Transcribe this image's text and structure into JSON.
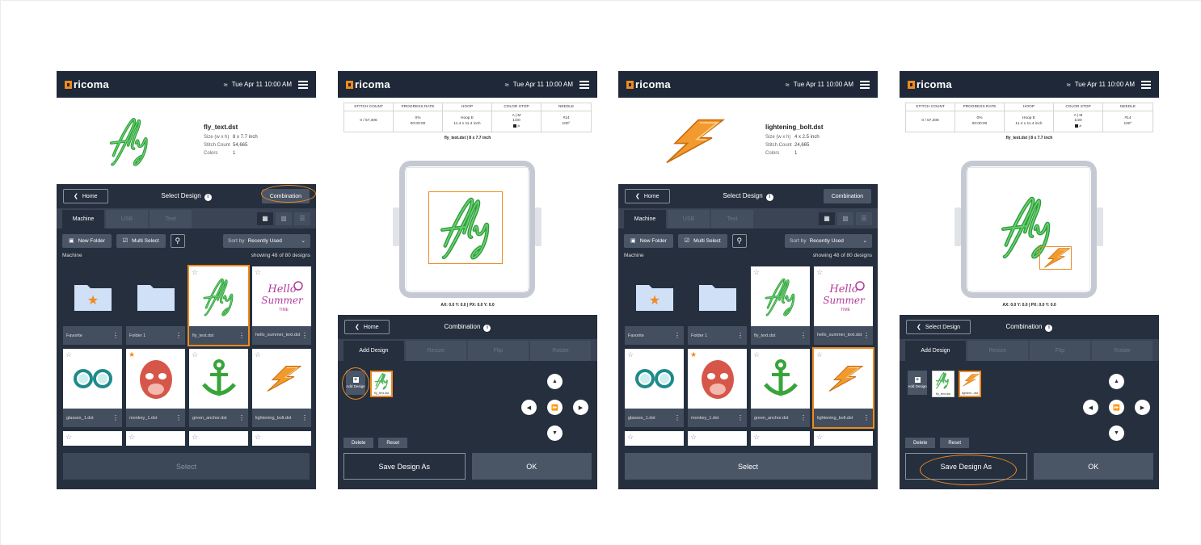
{
  "topbar": {
    "logo": "ricoma",
    "datetime": "Tue Apr 11  10:00 AM"
  },
  "select_panels": [
    {
      "file": {
        "name": "fly_text.dst",
        "size_label": "Size (w x h)",
        "size": "8 x 7.7 inch",
        "stitch_label": "Stitch Count",
        "stitch": "54,665",
        "colors_label": "Colors",
        "colors": "1"
      }
    },
    {
      "file": {
        "name": "lightening_bolt.dst",
        "size_label": "Size (w x h)",
        "size": "4 x 2.5 inch",
        "stitch_label": "Stitch Count",
        "stitch": "24,665",
        "colors_label": "Colors",
        "colors": "1"
      }
    }
  ],
  "select": {
    "home": "Home",
    "title": "Select Design",
    "combination": "Combination",
    "tabs": [
      "Machine",
      "USB",
      "Text"
    ],
    "new_folder": "New Folder",
    "multi_select": "Multi Select",
    "sort_by": "Sort by",
    "sort_value": "Recently Used",
    "location": "Machine",
    "showing": "showing 48 of 80 designs",
    "cards": [
      "Favorite",
      "Folder 1",
      "fly_text.dst",
      "hello_summer_text.dst",
      "glasses_1.dst",
      "monkey_1.dst",
      "green_anchor.dst",
      "lightening_bolt.dst"
    ],
    "select_button": "Select"
  },
  "combo": {
    "headers": [
      "STITCH COUNT",
      "PROGRESS RATE",
      "HOOP",
      "COLOR STOP",
      "NEEDLE"
    ],
    "stitch": "0 / 57,306",
    "progress": "0%",
    "time": "00:00:00",
    "hoop": "Hoop E",
    "hoop_size": "11.4 x 11.4 inch",
    "color_mode": "A | M",
    "color_stop": "1/20",
    "color_num": "#",
    "needle": "#14",
    "needle_angle": "100°",
    "file_line": "fly_text.dst  |  8 x 7.7 inch",
    "coords": "AX: 0.0  Y: 0.0  |  PX: 0.0  Y: 0.0",
    "home": "Home",
    "back_select": "Select Design",
    "title": "Combination",
    "tabs": [
      "Add Design",
      "Resize",
      "Flip",
      "Rotate"
    ],
    "add_design": "Add Design",
    "thumb1": "fly_text.dst",
    "thumb2": "lighteni...dst",
    "delete": "Delete",
    "reset": "Reset",
    "save_as": "Save Design As",
    "ok": "OK"
  },
  "colors": {
    "accent": "#f08a1e",
    "navy": "#1e2838",
    "panel": "#252f3e",
    "embroidery_green": "#3aa845"
  }
}
